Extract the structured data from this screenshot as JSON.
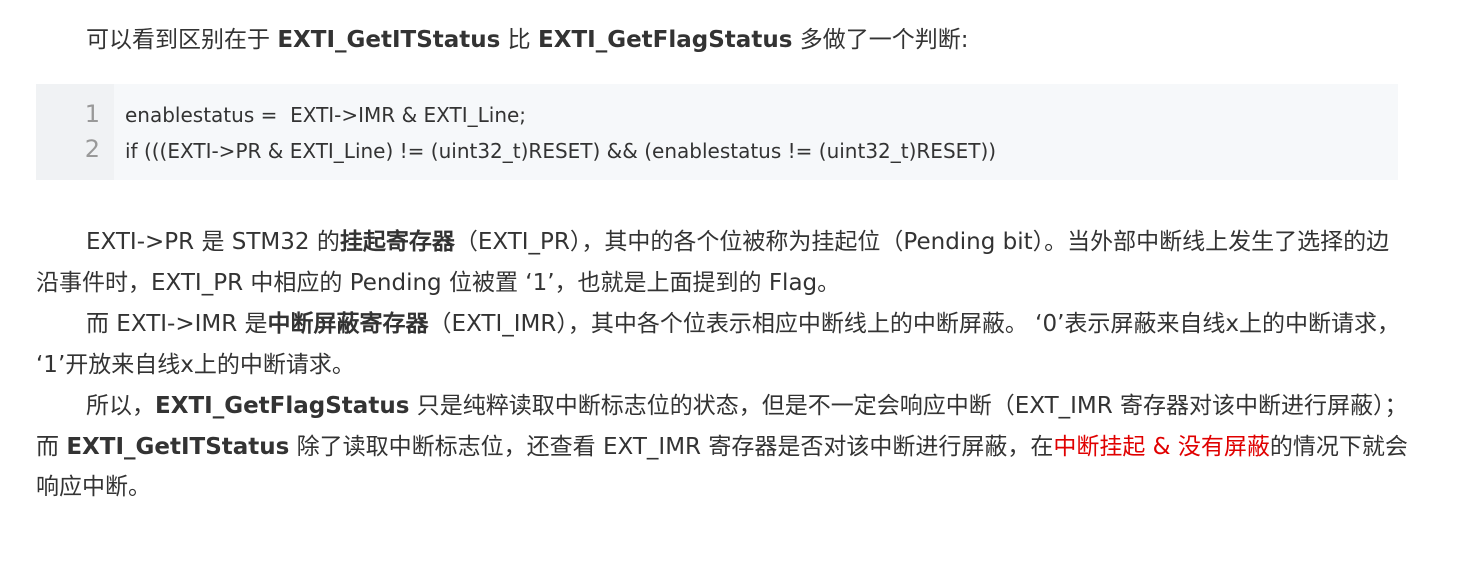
{
  "intro": {
    "t1": "可以看到区别在于 ",
    "b1": "EXTI_GetITStatus",
    "t2": " 比 ",
    "b2": "EXTI_GetFlagStatus",
    "t3": " 多做了一个判断:"
  },
  "code": {
    "lines": [
      {
        "num": "1",
        "text": "enablestatus =  EXTI->IMR & EXTI_Line;"
      },
      {
        "num": "2",
        "text": "if (((EXTI->PR & EXTI_Line) != (uint32_t)RESET) && (enablestatus != (uint32_t)RESET))"
      }
    ]
  },
  "p1": {
    "t1": "EXTI->PR 是 STM32 的",
    "b1": "挂起寄存器",
    "t2": "（EXTI_PR），其中的各个位被称为挂起位（Pending bit）。当外部中断线上发生了选择的边沿事件时，EXTI_PR 中相应的 Pending 位被置 ‘1’，也就是上面提到的 Flag。"
  },
  "p2": {
    "t1": "而 EXTI->IMR 是",
    "b1": "中断屏蔽寄存器",
    "t2": "（EXTI_IMR），其中各个位表示相应中断线上的中断屏蔽。 ‘0’表示屏蔽来自线x上的中断请求， ‘1’开放来自线x上的中断请求。"
  },
  "p3": {
    "t1": "所以，",
    "b1": "EXTI_GetFlagStatus",
    "t2": " 只是纯粹读取中断标志位的状态，但是不一定会响应中断（EXT_IMR 寄存器对该中断进行屏蔽）；而 ",
    "b2": "EXTI_GetITStatus",
    "t3": " 除了读取中断标志位，还查看 EXT_IMR 寄存器是否对该中断进行屏蔽，在",
    "r1": "中断挂起 & 没有屏蔽",
    "t4": "的情况下就会响应中断。"
  },
  "colors": {
    "text": "#333333",
    "highlight": "#e00000",
    "code_bg": "#f6f8fa",
    "line_number": "#999999"
  }
}
